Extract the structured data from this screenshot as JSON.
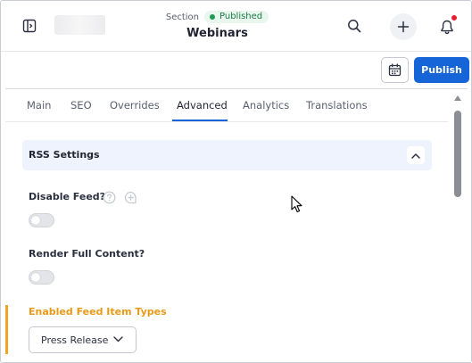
{
  "header": {
    "section_label": "Section",
    "status": "Published",
    "page_title": "Webinars",
    "icons": {
      "sidebar": "sidebar-toggle-icon",
      "search": "search-icon",
      "add": "plus-icon",
      "notifications": "bell-icon"
    },
    "notification_dot_color": "#e5202e"
  },
  "actions": {
    "schedule_icon": "calendar-icon",
    "publish_label": "Publish",
    "publish_color": "#1565d8"
  },
  "tabs": [
    {
      "label": "Main"
    },
    {
      "label": "SEO"
    },
    {
      "label": "Overrides"
    },
    {
      "label": "Advanced",
      "active": true
    },
    {
      "label": "Analytics"
    },
    {
      "label": "Translations"
    }
  ],
  "rss": {
    "title": "RSS Settings",
    "collapse_icon": "chevron-up-icon",
    "fields": {
      "disable_feed": {
        "label": "Disable Feed?",
        "enabled": false,
        "help_icon": "question-circle-icon",
        "comment_icon": "add-comment-icon"
      },
      "render_full_content": {
        "label": "Render Full Content?",
        "enabled": false
      },
      "enabled_feed_item_types": {
        "label": "Enabled Feed Item Types",
        "selected": "Press Release",
        "accent_color": "#f0a420"
      }
    }
  }
}
